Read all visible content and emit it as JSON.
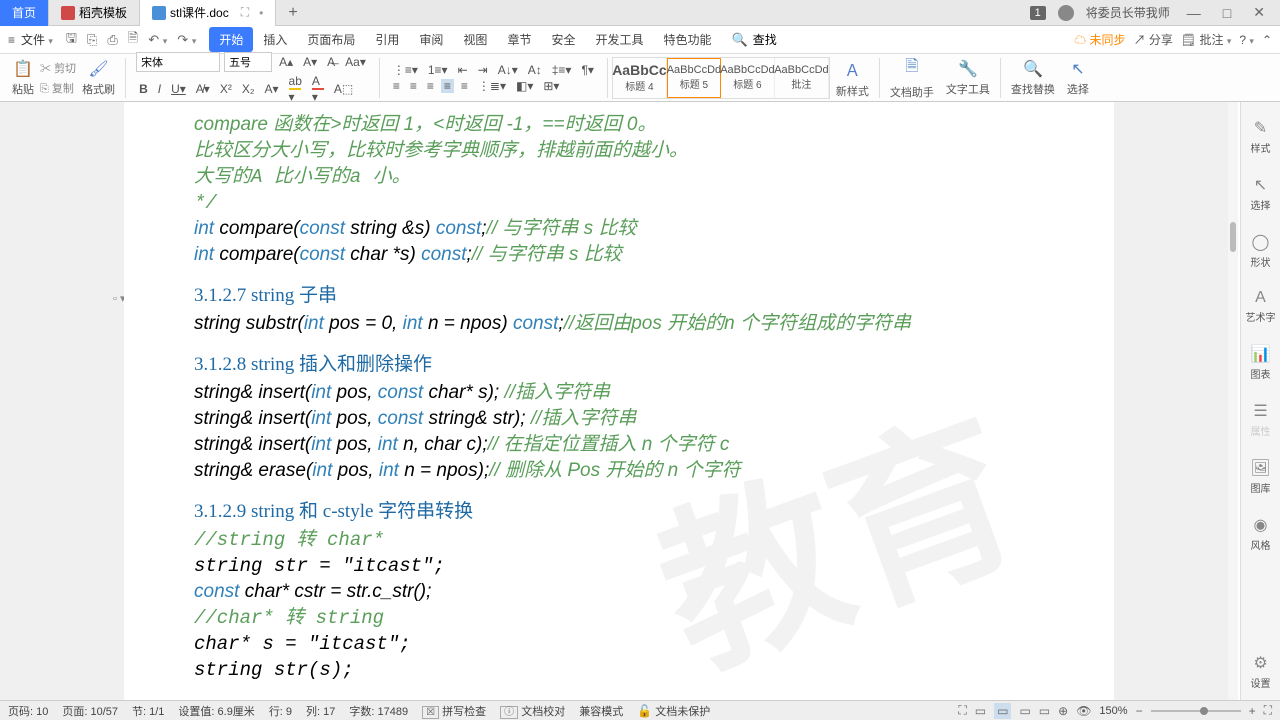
{
  "titlebar": {
    "tabs": [
      {
        "label": "首页",
        "type": "home"
      },
      {
        "label": "稻壳模板",
        "type": "doc",
        "icon": "red"
      },
      {
        "label": "stl课件.doc",
        "type": "doc",
        "icon": "blue",
        "active": true,
        "restorable": true
      }
    ],
    "badge": "1",
    "user": "将委员长带我师"
  },
  "menubar": {
    "file": "文件",
    "tabs": [
      "开始",
      "插入",
      "页面布局",
      "引用",
      "审阅",
      "视图",
      "章节",
      "安全",
      "开发工具",
      "特色功能"
    ],
    "active_tab": 0,
    "search": "查找",
    "right": {
      "sync": "未同步",
      "share": "分享",
      "note": "批注"
    }
  },
  "ribbon": {
    "paste": "粘贴",
    "cut": "剪切",
    "copy": "复制",
    "format_painter": "格式刷",
    "font_name": "宋体",
    "font_size": "五号",
    "styles": [
      {
        "preview": "AaBbCc",
        "label": "标题 4",
        "big": true
      },
      {
        "preview": "AaBbCcDd",
        "label": "标题 5",
        "current": true
      },
      {
        "preview": "AaBbCcDd",
        "label": "标题 6"
      },
      {
        "preview": "AaBbCcDd",
        "label": "批注"
      }
    ],
    "new_style": "新样式",
    "doc_helper": "文档助手",
    "text_tools": "文字工具",
    "find_replace": "查找替换",
    "select": "选择"
  },
  "doc": {
    "line1_a": "compare ",
    "line1_b": "函数在>时返回 1，<时返回 -1，==时返回 0。",
    "line2": "比较区分大小写，比较时参考字典顺序，排越前面的越小。",
    "line3": "大写的A 比小写的a 小。",
    "line4": "*/",
    "line5": {
      "p1": "int",
      "p2": " compare(",
      "p3": "const",
      "p4": " string &s) ",
      "p5": "const",
      "p6": ";",
      "c": "// 与字符串 s 比较"
    },
    "line6": {
      "p1": "int",
      "p2": " compare(",
      "p3": "const",
      "p4": " char *s) ",
      "p5": "const",
      "p6": ";",
      "c": "// 与字符串 s 比较"
    },
    "h1": "3.1.2.7 string 子串",
    "line7": {
      "a": "string substr(",
      "b": "int",
      "c": " pos = 0, ",
      "d": "int",
      "e": " n = npos) ",
      "f": "const",
      "g": ";",
      "h": "//返回由pos 开始的n 个字符组成的字符串"
    },
    "h2": "3.1.2.8 string 插入和删除操作",
    "line8": {
      "a": "string& insert(",
      "b": "int",
      "c": " pos, ",
      "d": "const",
      "e": " char* s); ",
      "f": "//插入字符串"
    },
    "line9": {
      "a": "string& insert(",
      "b": "int",
      "c": " pos, ",
      "d": "const",
      "e": " string& str); ",
      "f": "//插入字符串"
    },
    "line10": {
      "a": "string& insert(",
      "b": "int",
      "c": " pos, ",
      "d": "int",
      "e": " n, char c);",
      "f": "// 在指定位置插入 n 个字符 c"
    },
    "line11": {
      "a": "string& erase(",
      "b": "int",
      "c": " pos, ",
      "d": "int",
      "e": " n = npos);",
      "f": "// 删除从 Pos 开始的 n 个字符"
    },
    "h3": "3.1.2.9 string 和 c-style 字符串转换",
    "line12": "//string 转 char*",
    "line13": "string str = \"itcast\";",
    "line14": {
      "a": "const",
      "b": " char* cstr = str.c_str();"
    },
    "line15": "//char* 转 string",
    "line16": "char* s = \"itcast\";",
    "line17": "string str(s);"
  },
  "right_panel": [
    "样式",
    "选择",
    "形状",
    "艺术字",
    "图表",
    "属性",
    "图库",
    "风格",
    "设置"
  ],
  "statusbar": {
    "page_num": "页码: 10",
    "page": "页面: 10/57",
    "section": "节: 1/1",
    "pos": "设置值: 6.9厘米",
    "row": "行: 9",
    "col": "列: 17",
    "words": "字数: 17489",
    "spell": "拼写检查",
    "proofread": "文档校对",
    "compat": "兼容模式",
    "protect": "文档未保护",
    "zoom": "150%"
  }
}
